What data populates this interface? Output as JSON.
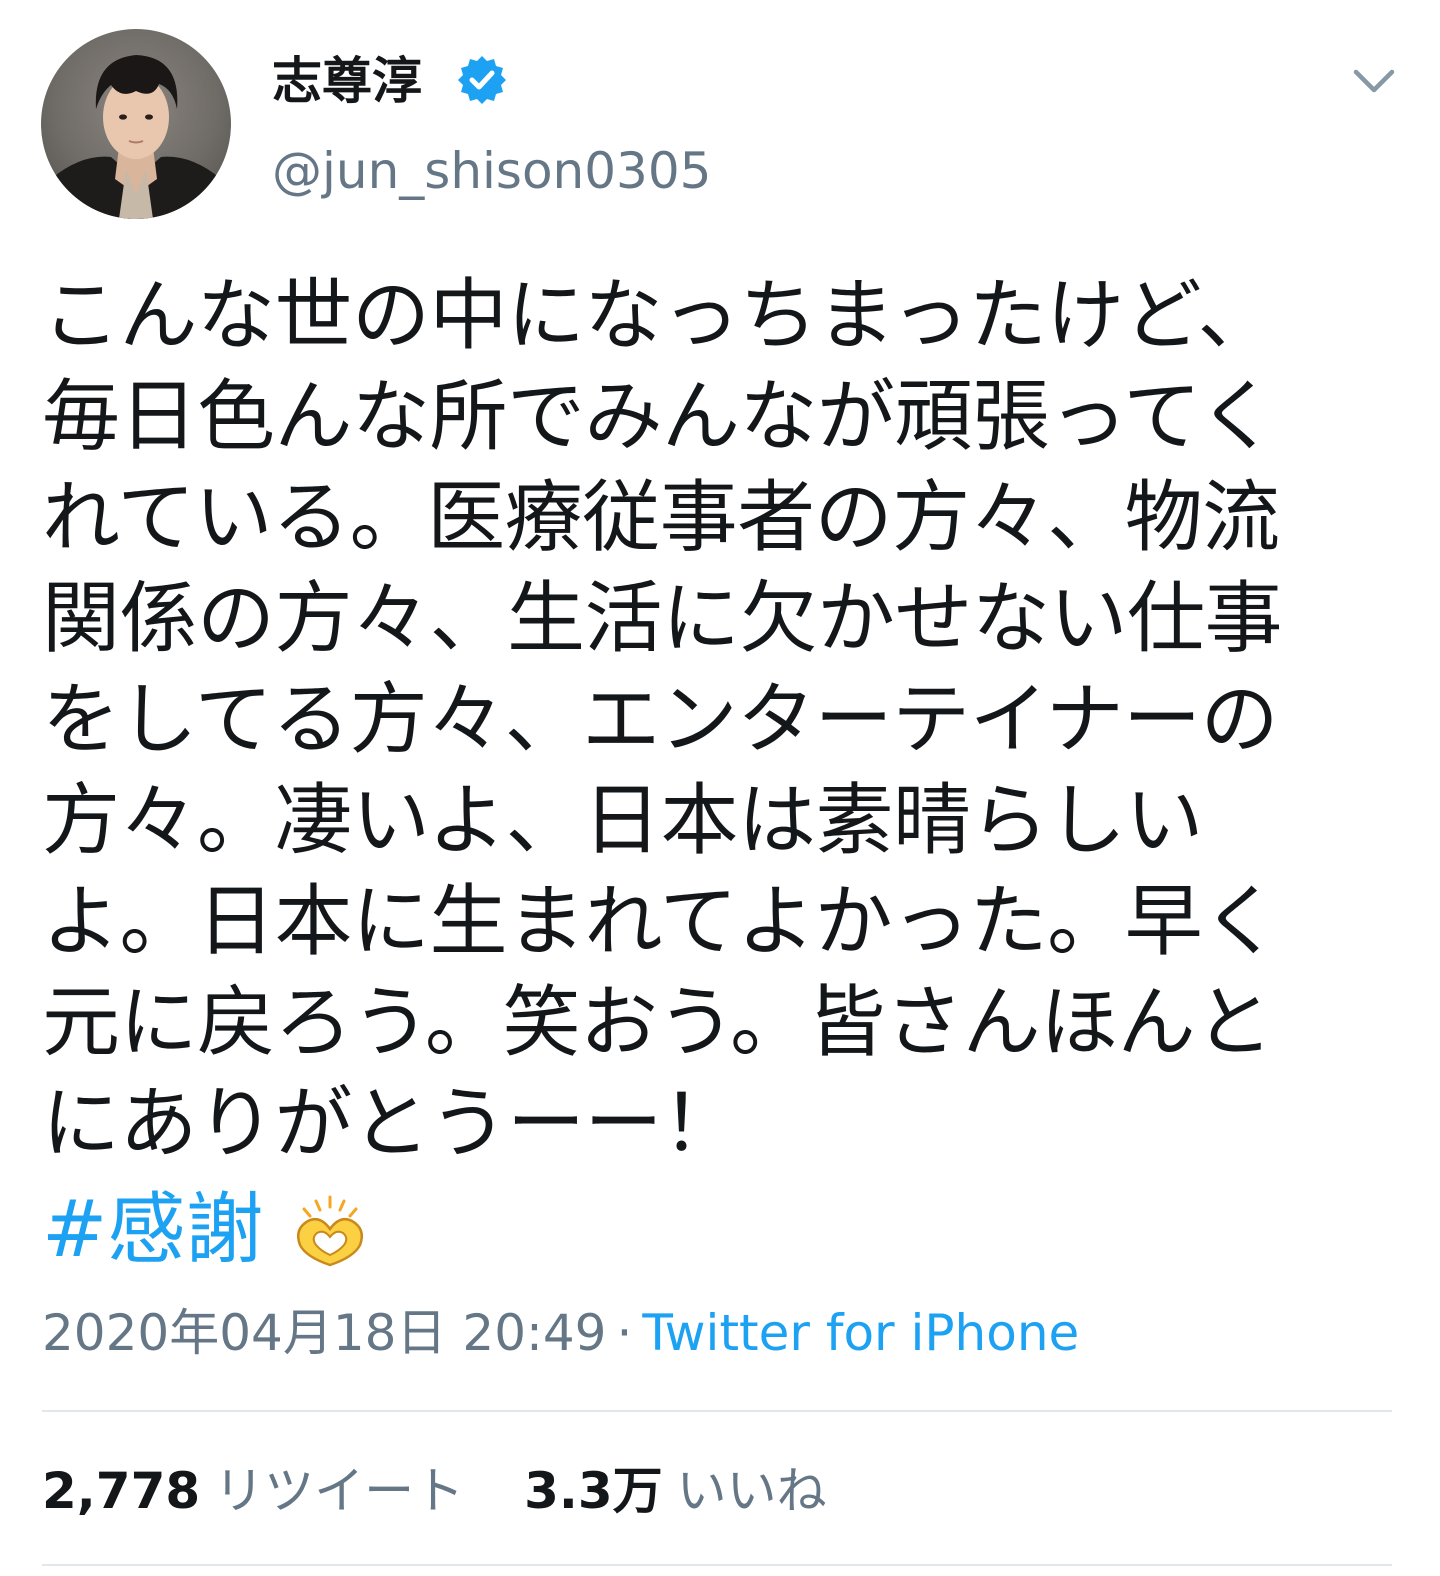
{
  "user": {
    "display_name": "志尊淳",
    "handle": "@jun_shison0305",
    "verified": true
  },
  "tweet": {
    "lines": [
      "こんな世の中になっちまったけど、",
      "毎日色んな所でみんなが頑張ってく",
      "れている。医療従事者の方々、物流",
      "関係の方々、生活に欠かせない仕事",
      "をしてる方々、エンターテイナーの",
      "方々。凄いよ、日本は素晴らしい",
      "よ。日本に生まれてよかった。早く",
      "元に戻ろう。笑おう。皆さんほんと",
      "にありがとうーー！"
    ],
    "hashtag": "#感謝",
    "emoji": "heart-hands-icon"
  },
  "meta": {
    "timestamp": "2020年04月18日 20:49",
    "separator": "·",
    "source": "Twitter for iPhone"
  },
  "stats": {
    "retweets_count": "2,778",
    "retweets_label": "リツイート",
    "likes_count": "3.3万",
    "likes_label": "いいね"
  },
  "colors": {
    "link": "#1da1f2",
    "secondary_text": "#657786",
    "primary_text": "#14171a",
    "divider": "#e1e8ed",
    "verified_badge": "#1da1f2"
  }
}
